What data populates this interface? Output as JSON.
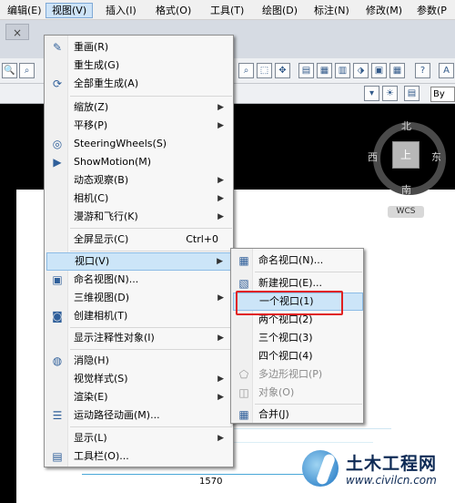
{
  "menubar": [
    {
      "label": "编辑(E)"
    },
    {
      "label": "视图(V)"
    },
    {
      "label": "插入(I)"
    },
    {
      "label": "格式(O)"
    },
    {
      "label": "工具(T)"
    },
    {
      "label": "绘图(D)"
    },
    {
      "label": "标注(N)"
    },
    {
      "label": "修改(M)"
    },
    {
      "label": "参数(P"
    }
  ],
  "view_menu": {
    "items": [
      {
        "label": "重画(R)",
        "icon": "pencil-icon",
        "shortcut": "",
        "submenu": false
      },
      {
        "label": "重生成(G)",
        "icon": "",
        "shortcut": "",
        "submenu": false
      },
      {
        "label": "全部重生成(A)",
        "icon": "regen-all-icon",
        "shortcut": "",
        "submenu": false
      },
      {
        "label": "缩放(Z)",
        "icon": "",
        "shortcut": "",
        "submenu": true
      },
      {
        "label": "平移(P)",
        "icon": "",
        "shortcut": "",
        "submenu": true
      },
      {
        "label": "SteeringWheels(S)",
        "icon": "steering-wheel-icon",
        "shortcut": "",
        "submenu": false
      },
      {
        "label": "ShowMotion(M)",
        "icon": "showmotion-icon",
        "shortcut": "",
        "submenu": false
      },
      {
        "label": "动态观察(B)",
        "icon": "",
        "shortcut": "",
        "submenu": true
      },
      {
        "label": "相机(C)",
        "icon": "",
        "shortcut": "",
        "submenu": true
      },
      {
        "label": "漫游和飞行(K)",
        "icon": "",
        "shortcut": "",
        "submenu": true
      },
      {
        "label": "全屏显示(C)",
        "icon": "",
        "shortcut": "Ctrl+0",
        "submenu": false
      },
      {
        "label": "视口(V)",
        "icon": "",
        "shortcut": "",
        "submenu": true
      },
      {
        "label": "命名视图(N)...",
        "icon": "named-view-icon",
        "shortcut": "",
        "submenu": false
      },
      {
        "label": "三维视图(D)",
        "icon": "",
        "shortcut": "",
        "submenu": true
      },
      {
        "label": "创建相机(T)",
        "icon": "camera-icon",
        "shortcut": "",
        "submenu": false
      },
      {
        "label": "显示注释性对象(I)",
        "icon": "",
        "shortcut": "",
        "submenu": true
      },
      {
        "label": "消隐(H)",
        "icon": "hide-icon",
        "shortcut": "",
        "submenu": false
      },
      {
        "label": "视觉样式(S)",
        "icon": "",
        "shortcut": "",
        "submenu": true
      },
      {
        "label": "渲染(E)",
        "icon": "",
        "shortcut": "",
        "submenu": true
      },
      {
        "label": "运动路径动画(M)...",
        "icon": "motion-path-icon",
        "shortcut": "",
        "submenu": false
      },
      {
        "label": "显示(L)",
        "icon": "",
        "shortcut": "",
        "submenu": true
      },
      {
        "label": "工具栏(O)...",
        "icon": "toolbar-icon",
        "shortcut": "",
        "submenu": false
      }
    ]
  },
  "viewport_submenu": {
    "items": [
      {
        "label": "命名视口(N)...",
        "icon": "named-viewport-icon"
      },
      {
        "label": "新建视口(E)...",
        "icon": "new-viewport-icon"
      },
      {
        "label": "一个视口(1)",
        "icon": ""
      },
      {
        "label": "两个视口(2)",
        "icon": ""
      },
      {
        "label": "三个视口(3)",
        "icon": ""
      },
      {
        "label": "四个视口(4)",
        "icon": ""
      },
      {
        "label": "多边形视口(P)",
        "icon": "polygon-viewport-icon"
      },
      {
        "label": "对象(O)",
        "icon": "object-viewport-icon"
      },
      {
        "label": "合并(J)",
        "icon": "join-icon"
      }
    ]
  },
  "tab": {
    "close_glyph": "×"
  },
  "toolbar_right": {
    "bylayer": "By"
  },
  "compass": {
    "north": "北",
    "south": "南",
    "east": "东",
    "west": "西",
    "face": "上"
  },
  "wcs": "WCS",
  "drawing": {
    "dimension": "1570"
  },
  "watermark": {
    "title": "土木工程网",
    "url": "www.civilcn.com"
  },
  "colors": {
    "highlight": "#cce5f8",
    "red_box": "#e02020"
  }
}
